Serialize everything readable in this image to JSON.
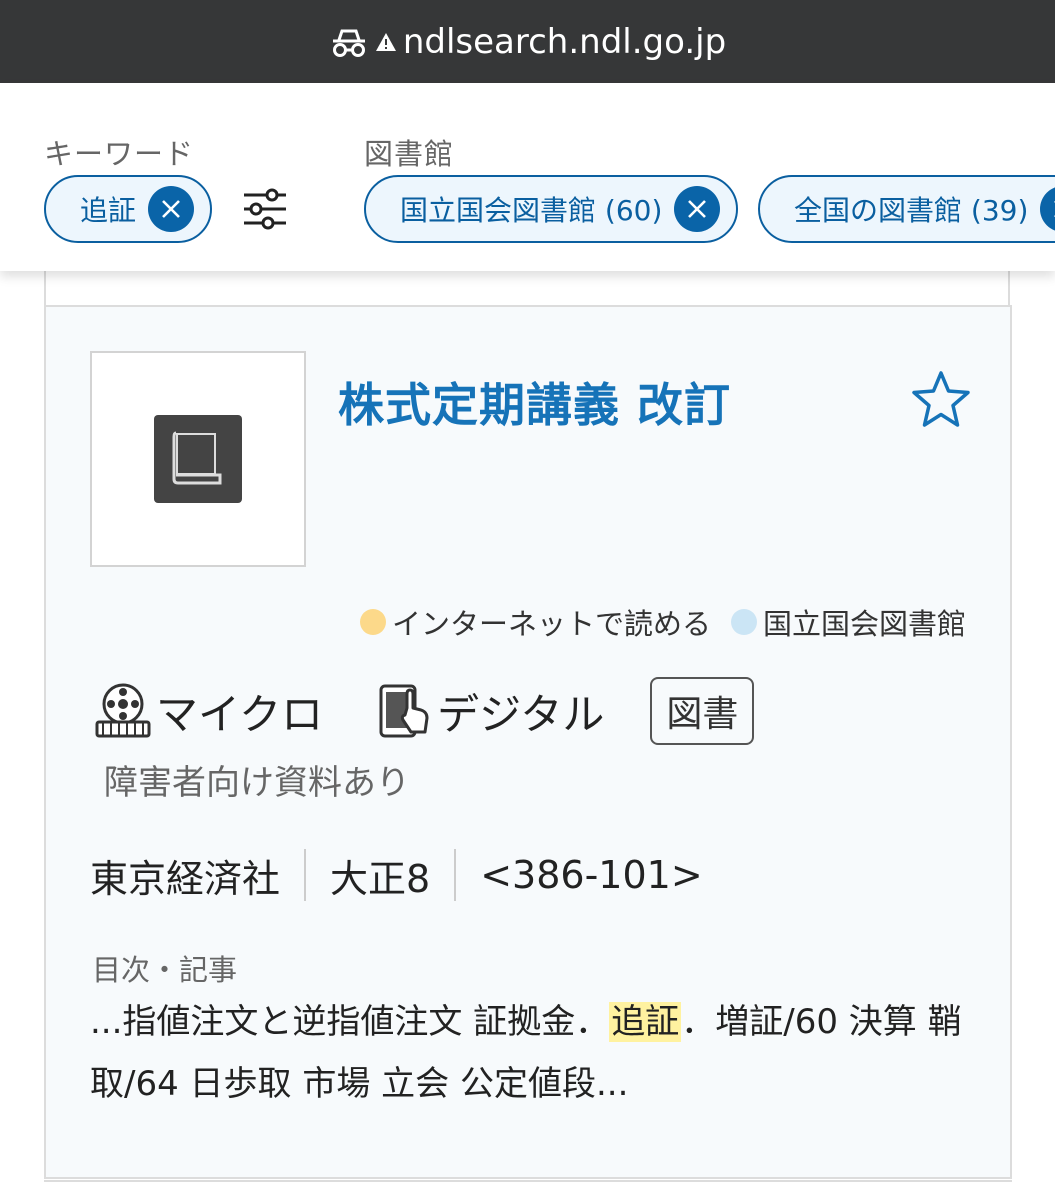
{
  "browser": {
    "url": "ndlsearch.ndl.go.jp",
    "incognito_icon": "incognito-icon",
    "warning_icon": "warning-icon"
  },
  "filters": {
    "keyword_label": "キーワード",
    "keyword_chip": "追証",
    "library_label": "図書館",
    "library_chips": [
      "国立国会図書館 (60)",
      "全国の図書館 (39)"
    ],
    "tune_icon": "tune-sliders-icon"
  },
  "result": {
    "title": "株式定期講義 改訂",
    "availability": [
      "インターネットで読める",
      "国立国会図書館"
    ],
    "media": {
      "micro": "マイクロ",
      "digital": "デジタル",
      "book_tag": "図書"
    },
    "accessible": "障害者向け資料あり",
    "publisher": "東京経済社",
    "year": "大正8",
    "call_number": "<386-101>",
    "toc_label": "目次・記事",
    "toc_before": "...指値注文と逆指値注文 証拠金．",
    "toc_highlight": "追証",
    "toc_after": "．増証/60 決算 鞘取/64 日歩取 市場 立会 公定値段..."
  },
  "colors": {
    "accent": "#1673b8",
    "chip_border": "#0a5fa0",
    "chip_bg": "#edf6fd",
    "highlight": "#fff2a0",
    "urlbar": "#363738"
  }
}
